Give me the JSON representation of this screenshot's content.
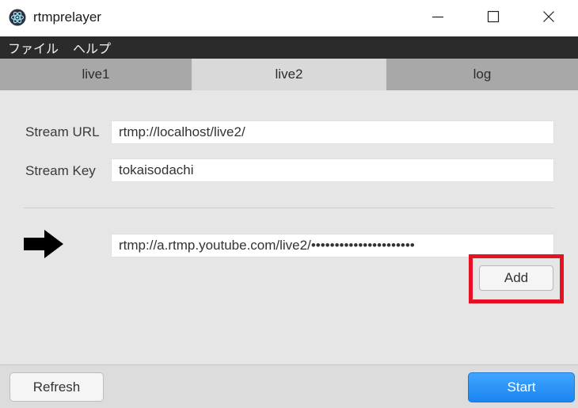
{
  "window": {
    "title": "rtmprelayer",
    "app_icon": "electron-atom-icon",
    "controls": {
      "minimize": "minimize-icon",
      "maximize": "maximize-icon",
      "close": "close-icon"
    }
  },
  "menu": {
    "file": "ファイル",
    "help": "ヘルプ"
  },
  "tabs": [
    {
      "label": "live1",
      "active": false
    },
    {
      "label": "live2",
      "active": true
    },
    {
      "label": "log",
      "active": false
    }
  ],
  "form": {
    "stream_url_label": "Stream URL",
    "stream_url_value": "rtmp://localhost/live2/",
    "stream_key_label": "Stream Key",
    "stream_key_value": "tokaisodachi",
    "destination_value": "rtmp://a.rtmp.youtube.com/live2/••••••••••••••••••••••",
    "arrow_icon": "right-arrow-icon"
  },
  "buttons": {
    "add": "Add",
    "refresh": "Refresh",
    "start": "Start"
  },
  "colors": {
    "highlight": "#e81123",
    "start_button": "#1a84f0",
    "menubar": "#2b2b2b"
  }
}
